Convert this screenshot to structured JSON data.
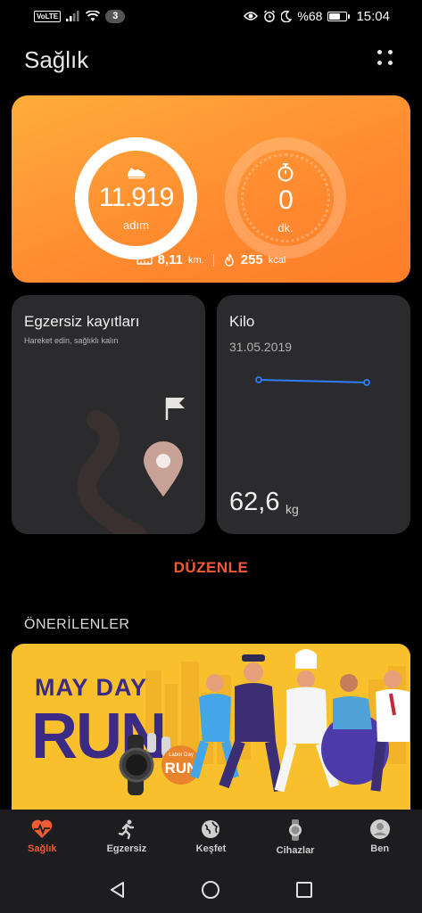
{
  "status_bar": {
    "volte": "VoLTE",
    "notification_count": "3",
    "battery_text": "%68",
    "battery_level_percent": 68,
    "time": "15:04"
  },
  "header": {
    "title": "Sağlık"
  },
  "activity": {
    "steps_value": "11.919",
    "steps_unit": "adım",
    "time_value": "0",
    "time_unit": "dk.",
    "distance_value": "8,11",
    "distance_unit": "km.",
    "calories_value": "255",
    "calories_unit": "kcal",
    "accent_color": "#ff8a2f"
  },
  "exercise": {
    "title": "Egzersiz kayıtları",
    "subtitle": "Hareket edin, sağlıklı kalın"
  },
  "weight": {
    "title": "Kilo",
    "date": "31.05.2019",
    "value": "62,6",
    "unit": "kg",
    "line_color": "#2f7cff"
  },
  "edit_label": "DÜZENLE",
  "recommendations": {
    "title": "ÖNERİLENLER",
    "banner": {
      "line1": "MAY DAY",
      "line2": "RUN",
      "badge_small": "Labor Day",
      "badge_big": "RUN"
    }
  },
  "bottom_nav": [
    {
      "label": "Sağlık",
      "icon": "heart-pulse-icon",
      "active": true
    },
    {
      "label": "Egzersiz",
      "icon": "runner-icon",
      "active": false
    },
    {
      "label": "Keşfet",
      "icon": "globe-icon",
      "active": false
    },
    {
      "label": "Cihazlar",
      "icon": "watch-icon",
      "active": false
    },
    {
      "label": "Ben",
      "icon": "person-icon",
      "active": false
    }
  ],
  "colors": {
    "accent": "#f05a34",
    "card_bg": "#2b2b2d",
    "banner_bg": "#f8c02d"
  }
}
